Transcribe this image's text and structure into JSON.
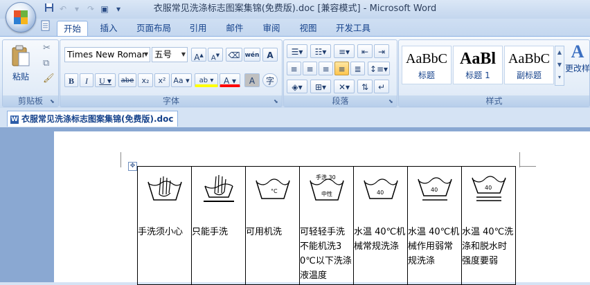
{
  "window": {
    "title": "衣服常见洗涤标志图案集锦(免费版).doc [兼容模式] - Microsoft Word"
  },
  "ribbon_tabs": [
    "开始",
    "插入",
    "页面布局",
    "引用",
    "邮件",
    "审阅",
    "视图",
    "开发工具"
  ],
  "active_tab": "开始",
  "clipboard": {
    "paste_label": "粘贴",
    "group_label": "剪贴板"
  },
  "font": {
    "font_name": "Times New Romar",
    "font_size": "五号",
    "grow_label": "A",
    "shrink_label": "A",
    "phonetic_label": "wén",
    "bold_label": "B",
    "italic_label": "I",
    "underline_label": "U",
    "strike_label": "abe",
    "subscript_label": "x₂",
    "superscript_label": "x²",
    "case_label": "Aa",
    "highlight_label": "ab",
    "fontcolor_label": "A",
    "charshading_label": "A",
    "enclosed_label": "字",
    "group_label": "字体"
  },
  "paragraph": {
    "group_label": "段落"
  },
  "styles": {
    "items": [
      {
        "sample": "AaBbC",
        "name": "标题"
      },
      {
        "sample": "AaBl",
        "name": "标题 1"
      },
      {
        "sample": "AaBbC",
        "name": "副标题"
      }
    ],
    "change_label": "更改样",
    "group_label": "样式"
  },
  "document_tab": {
    "label": "衣服常见洗涤标志图案集锦(免费版).doc"
  },
  "symbols": [
    {
      "icon": "hand-wash-careful-icon",
      "text": "手洗须小心"
    },
    {
      "icon": "hand-wash-only-icon",
      "text": "只能手洗"
    },
    {
      "icon": "machine-wash-icon",
      "text": "可用机洗"
    },
    {
      "icon": "gentle-hand-wash-30-icon",
      "icon_top": "手洗 30",
      "icon_bottom": "中性",
      "text": "可轻轻手洗不能机洗30℃以下洗涤液温度"
    },
    {
      "icon": "wash-40-normal-icon",
      "icon_value": "40",
      "text": "水温 40℃机械常规洗涤"
    },
    {
      "icon": "wash-40-gentle-icon",
      "icon_value": "40",
      "text": "水温 40℃机械作用弱常规洗涤"
    },
    {
      "icon": "wash-40-very-gentle-icon",
      "icon_value": "40",
      "text": "水温 40℃洗涤和脱水时强度要弱"
    }
  ]
}
